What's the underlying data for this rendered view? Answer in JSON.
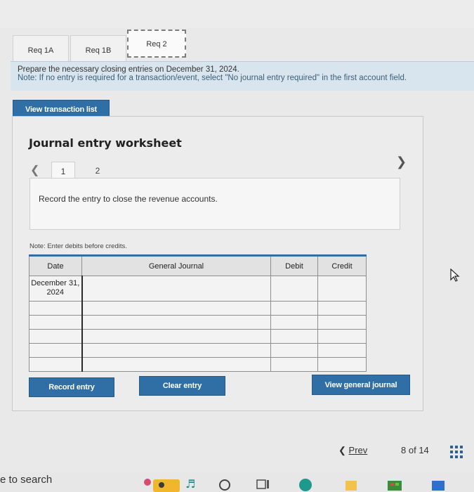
{
  "tabs": [
    {
      "label": "Req 1A"
    },
    {
      "label": "Req 1B"
    },
    {
      "label": "Req 2"
    }
  ],
  "instruction": {
    "line1": "Prepare the necessary closing entries on December 31, 2024.",
    "line2": "Note: If no entry is required for a transaction/event, select \"No journal entry required\" in the first account field."
  },
  "view_transaction_list_label": "View transaction list",
  "worksheet": {
    "title": "Journal entry worksheet",
    "entry_tabs": [
      "1",
      "2"
    ],
    "entry_prompt": "Record the entry to close the revenue accounts.",
    "note": "Note: Enter debits before credits."
  },
  "journal": {
    "headers": {
      "date": "Date",
      "account": "General Journal",
      "debit": "Debit",
      "credit": "Credit"
    },
    "first_date": "December 31, 2024"
  },
  "buttons": {
    "record": "Record entry",
    "clear": "Clear entry",
    "view_general": "View general journal"
  },
  "footer": {
    "prev": "Prev",
    "page_current": "8",
    "page_of": "of",
    "page_total": "14"
  },
  "taskbar": {
    "search_text": "e to search"
  },
  "colors": {
    "accent": "#2f6fa5",
    "instruction_bg": "#d9e5ee"
  }
}
